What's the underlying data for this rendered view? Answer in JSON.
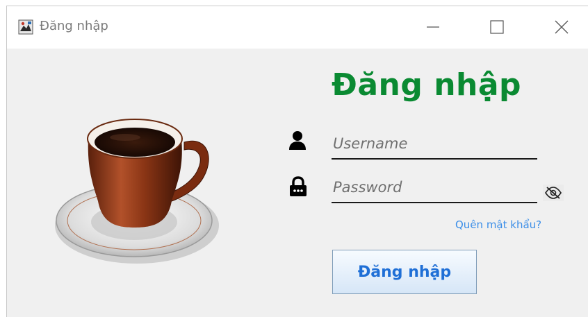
{
  "window": {
    "title": "Đăng nhập",
    "controls": {
      "minimize_icon": "minimize-icon",
      "maximize_icon": "maximize-icon",
      "close_icon": "close-icon"
    }
  },
  "form": {
    "heading": "Đăng nhập",
    "username": {
      "placeholder": "Username",
      "value": "",
      "icon": "user-icon"
    },
    "password": {
      "placeholder": "Password",
      "value": "",
      "icon": "lock-icon",
      "toggle_icon": "eye-slash-icon"
    },
    "forgot_link": "Quên mật khẩu?",
    "submit_label": "Đăng nhập"
  },
  "colors": {
    "heading": "#0a8a32",
    "link": "#3b8ee8",
    "button_text": "#1f6fd6",
    "background": "#f0f0f0"
  }
}
